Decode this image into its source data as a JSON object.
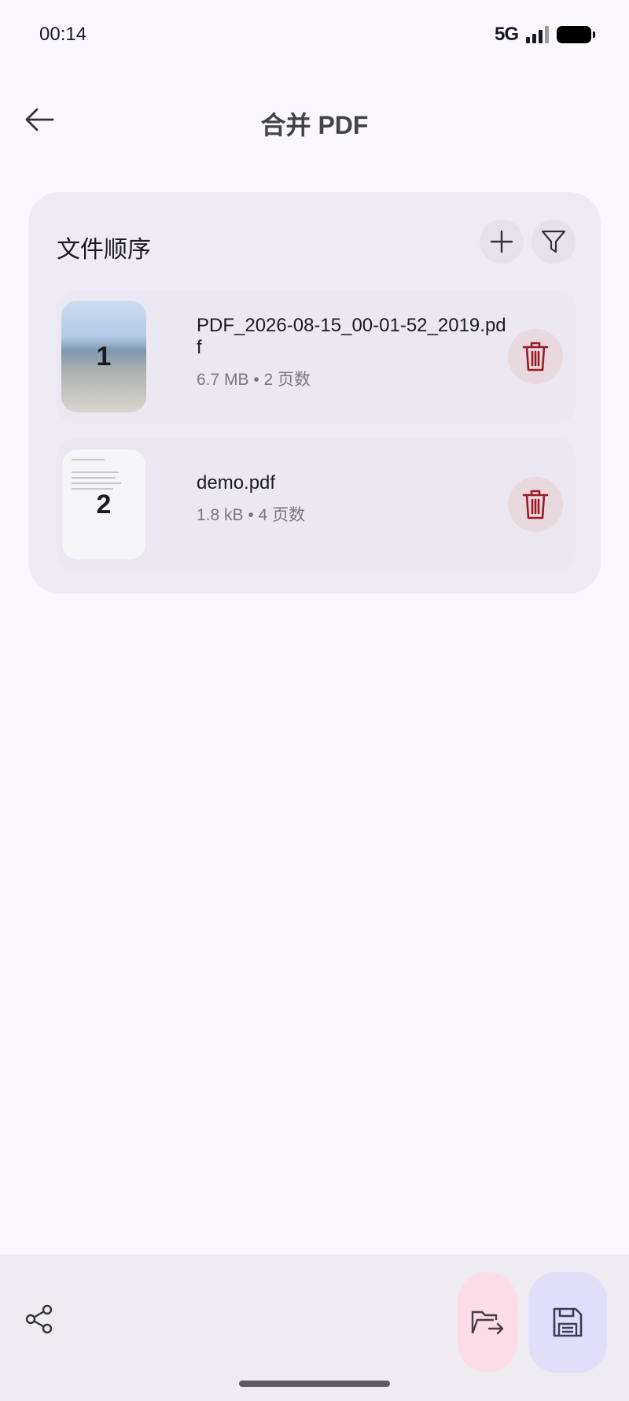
{
  "status_bar": {
    "time": "00:14",
    "network": "5G"
  },
  "app_bar": {
    "title": "合并 PDF",
    "back_icon": "arrow-left-icon"
  },
  "card": {
    "title": "文件顺序",
    "add_icon": "plus-icon",
    "filter_icon": "filter-icon"
  },
  "files": [
    {
      "index": "1",
      "name": "PDF_2026-08-15_00-01-52_2019.pdf",
      "meta": "6.7 MB • 2 页数",
      "delete_icon": "trash-icon"
    },
    {
      "index": "2",
      "name": "demo.pdf",
      "meta": "1.8 kB • 4 页数",
      "delete_icon": "trash-icon"
    }
  ],
  "bottom_bar": {
    "share_icon": "share-icon",
    "open_icon": "folder-open-icon",
    "save_icon": "save-icon"
  },
  "colors": {
    "background": "#faf8fd",
    "card": "#efebf3",
    "delete_accent": "#9a1b24",
    "fab_open": "#fbdde8",
    "fab_save": "#e1defa"
  }
}
